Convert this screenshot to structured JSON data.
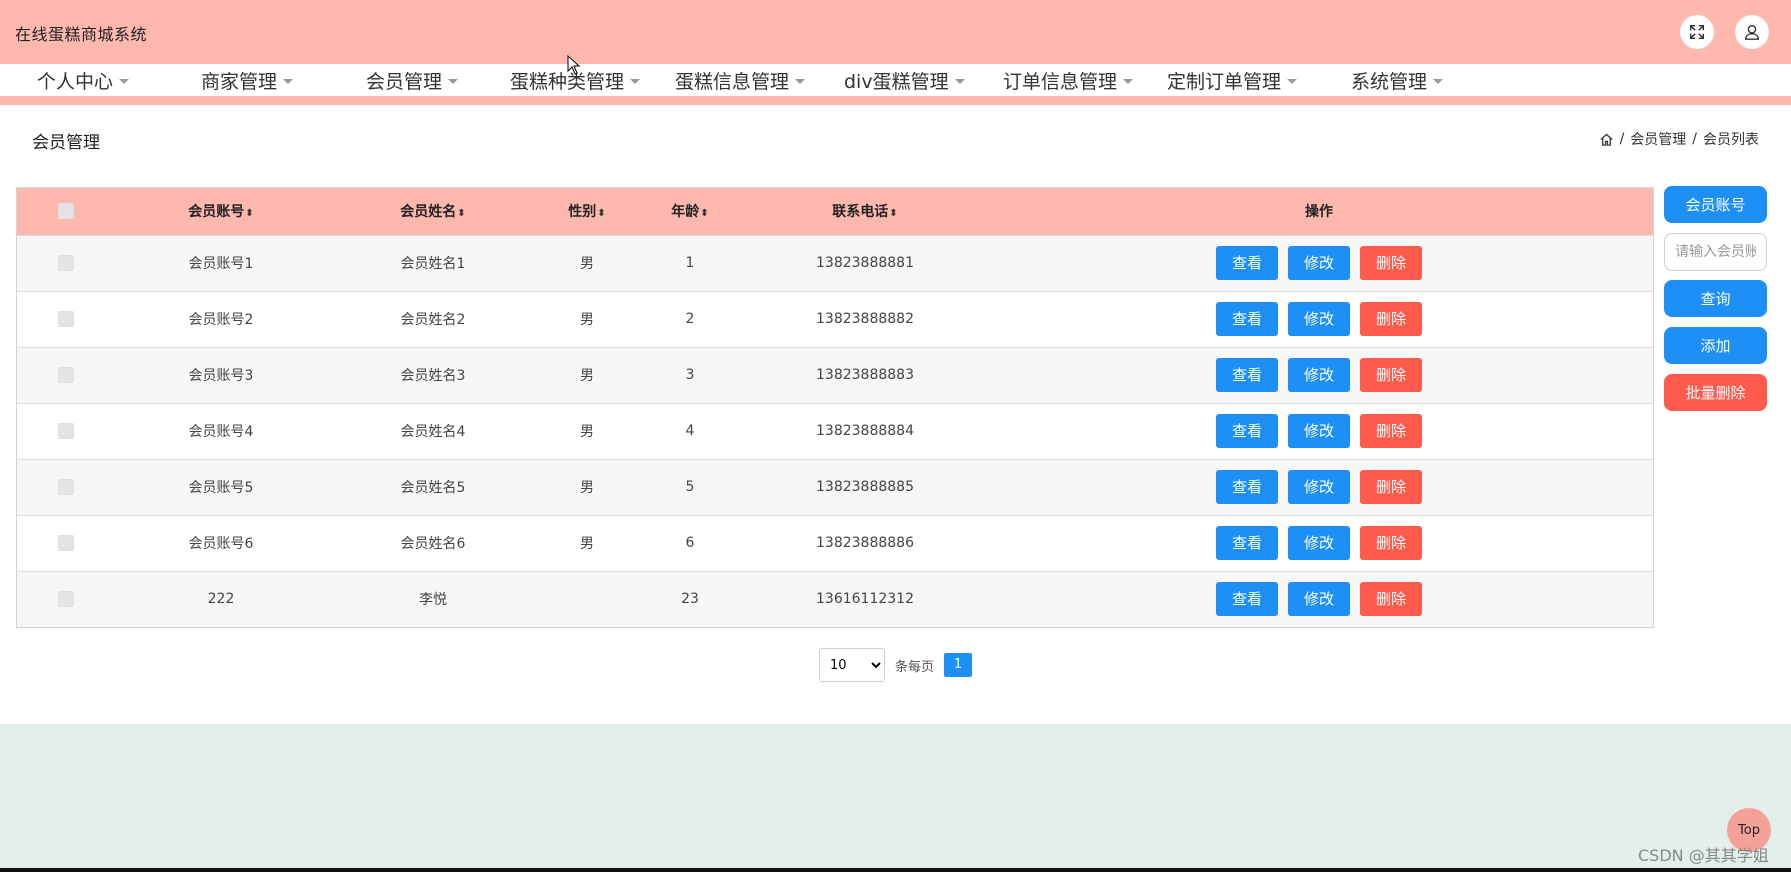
{
  "app": {
    "title": "在线蛋糕商城系统"
  },
  "header": {
    "fullscreen_icon": "expand-icon",
    "user_icon": "user-icon"
  },
  "nav": {
    "items": [
      {
        "label": "个人中心"
      },
      {
        "label": "商家管理"
      },
      {
        "label": "会员管理"
      },
      {
        "label": "蛋糕种类管理"
      },
      {
        "label": "蛋糕信息管理"
      },
      {
        "label": "div蛋糕管理"
      },
      {
        "label": "订单信息管理"
      },
      {
        "label": "定制订单管理"
      },
      {
        "label": "系统管理"
      }
    ]
  },
  "page": {
    "heading": "会员管理",
    "breadcrumb": {
      "home_icon": "home-icon",
      "sep": "/",
      "level1": "会员管理",
      "level2": "会员列表"
    }
  },
  "table": {
    "sort_symbol": "⬍",
    "columns": [
      "会员账号",
      "会员姓名",
      "性别",
      "年龄",
      "联系电话",
      "操作"
    ],
    "rows": [
      {
        "account": "会员账号1",
        "name": "会员姓名1",
        "gender": "男",
        "age": "1",
        "phone": "13823888881"
      },
      {
        "account": "会员账号2",
        "name": "会员姓名2",
        "gender": "男",
        "age": "2",
        "phone": "13823888882"
      },
      {
        "account": "会员账号3",
        "name": "会员姓名3",
        "gender": "男",
        "age": "3",
        "phone": "13823888883"
      },
      {
        "account": "会员账号4",
        "name": "会员姓名4",
        "gender": "男",
        "age": "4",
        "phone": "13823888884"
      },
      {
        "account": "会员账号5",
        "name": "会员姓名5",
        "gender": "男",
        "age": "5",
        "phone": "13823888885"
      },
      {
        "account": "会员账号6",
        "name": "会员姓名6",
        "gender": "男",
        "age": "6",
        "phone": "13823888886"
      },
      {
        "account": "222",
        "name": "李悦",
        "gender": "",
        "age": "23",
        "phone": "13616112312"
      }
    ],
    "actions": {
      "view": "查看",
      "edit": "修改",
      "delete": "删除"
    }
  },
  "search": {
    "field_label": "会员账号",
    "placeholder": "请输入会员账号",
    "query_button": "查询",
    "add_button": "添加",
    "batch_delete_button": "批量删除"
  },
  "pagination": {
    "page_size": "10",
    "per_page_label": "条每页",
    "current_page": "1",
    "page_size_options": [
      "10"
    ]
  },
  "footer": {
    "top_button": "Top",
    "watermark": "CSDN @其其学姐"
  },
  "colors": {
    "header_bg": "#feb8ae",
    "primary": "#1e90f5",
    "danger": "#ff5b4d",
    "footer_bg": "#e3efea"
  }
}
